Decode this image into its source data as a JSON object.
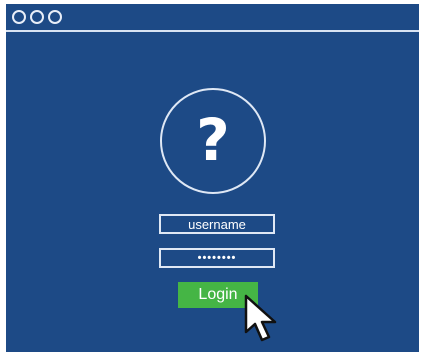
{
  "window": {
    "controls": [
      "close",
      "minimize",
      "maximize"
    ]
  },
  "avatar": {
    "glyph": "?"
  },
  "login_form": {
    "username_placeholder": "username",
    "password_value": "••••••••",
    "login_label": "Login"
  },
  "colors": {
    "window_background": "#1d4a86",
    "accent_green": "#45b545",
    "outline": "#dfe8f5"
  }
}
